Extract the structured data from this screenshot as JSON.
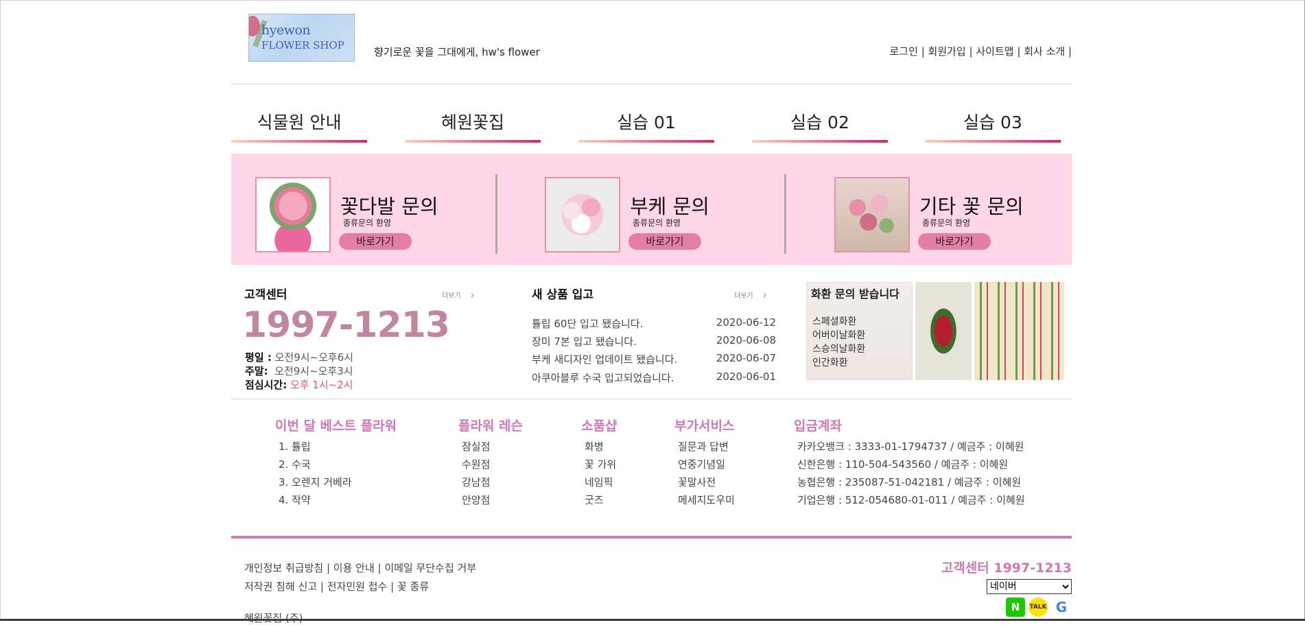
{
  "header": {
    "logo": {
      "line1": "hyewon",
      "line2": "FLOWER SHOP"
    },
    "tagline": "향기로운 꽃을 그대에게, hw's flower",
    "top_links": [
      "로그인",
      "회원가입",
      "사이트맵",
      "회사 소개"
    ],
    "separator": "|"
  },
  "menu": [
    "식물원 안내",
    "혜원꽃집",
    "실습 01",
    "실습 02",
    "실습 03"
  ],
  "banner": {
    "items": [
      {
        "title": "꽃다발 문의",
        "sub": "종류문의 환영",
        "button": "바로가기"
      },
      {
        "title": "부케 문의",
        "sub": "종류문의 환영",
        "button": "바로가기"
      },
      {
        "title": "기타 꽃 문의",
        "sub": "종류문의 환영",
        "button": "바로가기"
      }
    ]
  },
  "customer_center": {
    "title": "고객센터",
    "more": "더보기",
    "phone": "1997-1213",
    "weekday_label": "평일 :",
    "weekday": "오전9시~오후6시",
    "weekend_label": "주말:",
    "weekend": "오전9시~오후3시",
    "lunch_label": "점심시간:",
    "lunch": "오후 1시~2시"
  },
  "news": {
    "title": "새 상품 입고",
    "more": "더보기",
    "items": [
      {
        "text": "튤립 60단 입고 됐습니다.",
        "date": "2020-06-12"
      },
      {
        "text": "장미 7본 입고 됐습니다.",
        "date": "2020-06-08"
      },
      {
        "text": "부케 새디자인 업데이트 됐습니다.",
        "date": "2020-06-07"
      },
      {
        "text": "아쿠아블루 수국 입고되었습니다.",
        "date": "2020-06-01"
      }
    ]
  },
  "wreath_ad": {
    "title": "화환 문의 받습니다",
    "lines": [
      "스페셜화환",
      "어버이날화환",
      "스승의날화환",
      "인간화환"
    ]
  },
  "footer_columns": [
    {
      "heading": "이번 달 베스트 플라워",
      "items": [
        "1. 튤립",
        "2. 수국",
        "3. 오렌지 거베라",
        "4. 작약"
      ]
    },
    {
      "heading": "플라워 레슨",
      "items": [
        "잠실점",
        "수원점",
        "강남점",
        "안양점"
      ]
    },
    {
      "heading": "소품샵",
      "items": [
        "화병",
        "꽃 가위",
        "네임픽",
        "굿즈"
      ]
    },
    {
      "heading": "부가서비스",
      "items": [
        "질문과 답변",
        "연중기념일",
        "꽃말사전",
        "메세지도우미"
      ]
    },
    {
      "heading": "입금계좌",
      "items": [
        "카카오뱅크 : 3333-01-1794737 / 예금주 : 이혜원",
        "신한은행 : 110-504-543560 / 예금주 : 이혜원",
        "농협은행 : 235087-51-042181 / 예금주 : 이혜원",
        "기업은행 : 512-054680-01-011 / 예금주 : 이혜원"
      ]
    }
  ],
  "bottom": {
    "row1": [
      "개인정보 취급방침",
      "이용 안내",
      "이메일 무단수집 거부"
    ],
    "row2": [
      "저작권 침해 신고",
      "전자민원 접수",
      "꽃 종류"
    ],
    "company": "혜원꽃집 (주)",
    "cs_label": "고객센터 1997-1213",
    "search_select": "네이버",
    "sns": [
      {
        "icon": "naver-icon",
        "glyph": "N"
      },
      {
        "icon": "kakaotalk-icon",
        "glyph": "TALK"
      },
      {
        "icon": "google-icon",
        "glyph": "G"
      }
    ]
  },
  "colors": {
    "accent_pink": "#cf78b3",
    "banner_bg": "#fed6e6",
    "button_pink": "#e47ea6",
    "phone": "#c187a2",
    "lunch_red": "#e14f7d"
  }
}
